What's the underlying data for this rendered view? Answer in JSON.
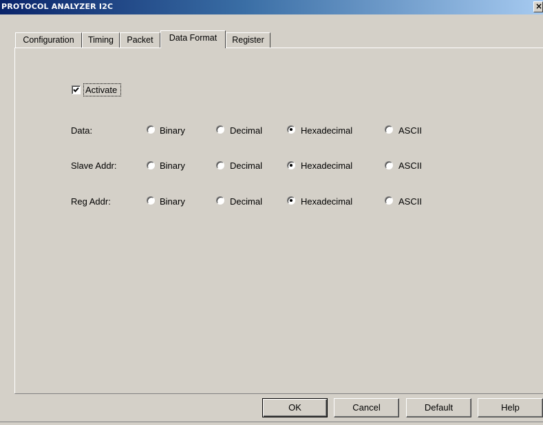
{
  "window": {
    "title": "PROTOCOL ANALYZER I2C",
    "close_glyph": "×"
  },
  "tabs": [
    {
      "label": "Configuration",
      "selected": false
    },
    {
      "label": "Timing",
      "selected": false
    },
    {
      "label": "Packet",
      "selected": false
    },
    {
      "label": "Data Format",
      "selected": true
    },
    {
      "label": "Register",
      "selected": false
    }
  ],
  "activate": {
    "label": "Activate",
    "checked": true
  },
  "format_options": [
    "Binary",
    "Decimal",
    "Hexadecimal",
    "ASCII"
  ],
  "rows": [
    {
      "label": "Data:",
      "selected": "Hexadecimal"
    },
    {
      "label": "Slave Addr:",
      "selected": "Hexadecimal"
    },
    {
      "label": "Reg Addr:",
      "selected": "Hexadecimal"
    }
  ],
  "buttons": {
    "ok": "OK",
    "cancel": "Cancel",
    "default": "Default",
    "help": "Help"
  },
  "colors": {
    "face": "#d4d0c8",
    "title_start": "#0a246a",
    "title_end": "#a6caf0"
  },
  "icons": {
    "close": "close-icon",
    "check": "checkmark-icon"
  }
}
